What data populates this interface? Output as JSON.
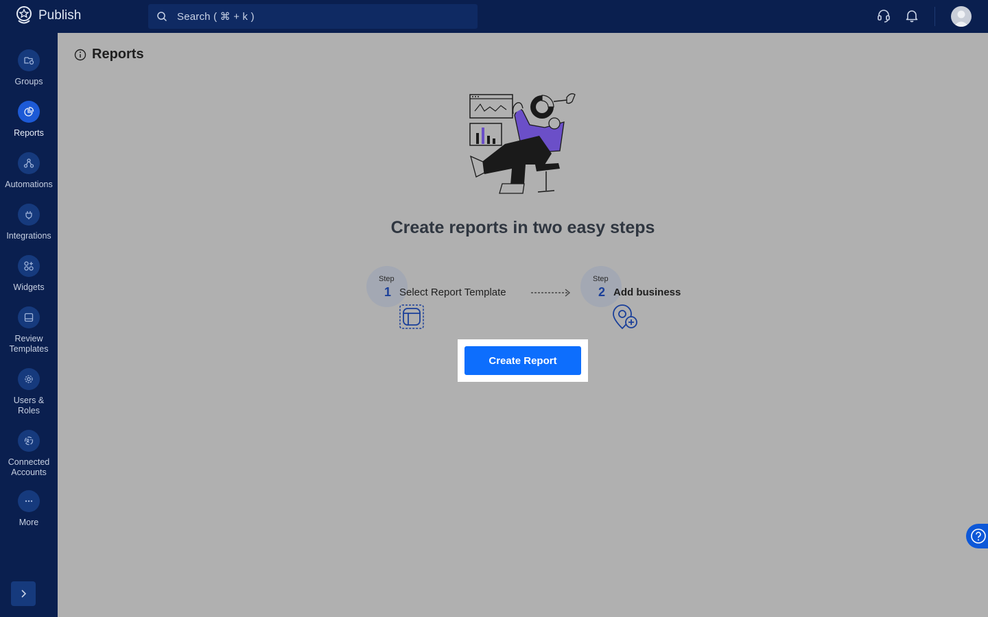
{
  "app": {
    "name": "Publish"
  },
  "search": {
    "placeholder": "Search ( ⌘ + k )"
  },
  "sidebar": {
    "items": [
      {
        "label": "Groups",
        "icon": "groups-icon"
      },
      {
        "label": "Reports",
        "icon": "reports-pie-icon",
        "active": true
      },
      {
        "label": "Automations",
        "icon": "automations-icon"
      },
      {
        "label": "Integrations",
        "icon": "integrations-plug-icon"
      },
      {
        "label": "Widgets",
        "icon": "widgets-icon"
      },
      {
        "label": "Review Templates",
        "icon": "review-templates-icon"
      },
      {
        "label": "Users & Roles",
        "icon": "gear-icon"
      },
      {
        "label": "Connected Accounts",
        "icon": "connected-accounts-icon"
      },
      {
        "label": "More",
        "icon": "more-dots-icon"
      }
    ]
  },
  "page": {
    "title": "Reports"
  },
  "hero": {
    "headline": "Create reports in two easy steps"
  },
  "steps": [
    {
      "word": "Step",
      "number": "1",
      "label": "Select Report Template"
    },
    {
      "word": "Step",
      "number": "2",
      "label": "Add business"
    }
  ],
  "cta": {
    "label": "Create Report"
  },
  "colors": {
    "topbar": "#0a1f4f",
    "accent": "#0d6efd",
    "overlay": "#b0b0b0"
  }
}
